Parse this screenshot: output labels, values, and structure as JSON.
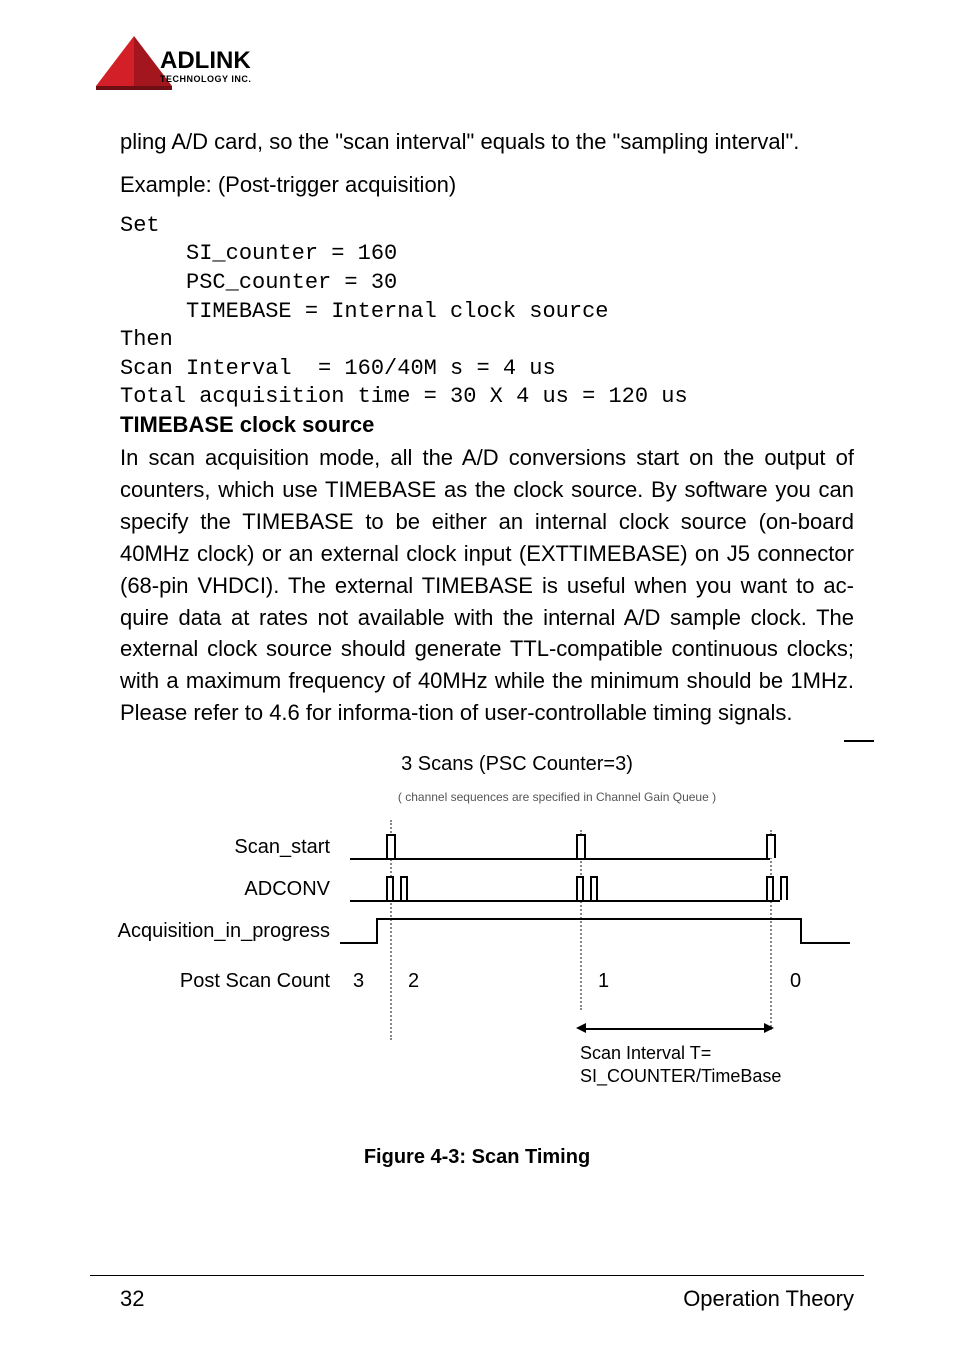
{
  "logo": {
    "brand_top": "ADLINK",
    "brand_bottom": "TECHNOLOGY INC."
  },
  "para1": "pling A/D card, so the \"scan interval\" equals to the \"sampling interval\".",
  "example_label": "Example: (Post-trigger acquisition)",
  "code_block": "Set\n     SI_counter = 160\n     PSC_counter = 30\n     TIMEBASE = Internal clock source\nThen\nScan Interval  = 160/40M s = 4 us\nTotal acquisition time = 30 X 4 us = 120 us",
  "heading_timebase": "TIMEBASE clock source",
  "para_timebase": "In scan acquisition mode, all the A/D conversions start on the output of counters, which use TIMEBASE as the clock source. By software you can specify the TIMEBASE to be either an internal clock source (on-board 40MHz clock) or an external clock input (EXTTIMEBASE) on J5 connector (68-pin VHDCI). The external TIMEBASE is useful when you want to ac-quire data at rates not available with the internal A/D sample clock. The external clock source should generate TTL-compatible continuous clocks; with a maximum frequency of 40MHz while the minimum should be 1MHz. Please refer to 4.6 for informa-tion of user-controllable timing signals.",
  "diagram": {
    "title": "3 Scans (PSC  Counter=3)",
    "subtitle": "( channel sequences are specified in Channel Gain Queue )",
    "signals": {
      "scan_start": "Scan_start",
      "adconv": "ADCONV",
      "acq_prog": "Acquisition_in_progress",
      "post_scan": "Post Scan Count"
    },
    "counts": [
      "3",
      "2",
      "1",
      "0"
    ],
    "scan_interval_label": "Scan Interval T=\nSI_COUNTER/TimeBase"
  },
  "figure_caption": "Figure 4-3: Scan Timing",
  "footer": {
    "page": "32",
    "section": "Operation Theory"
  }
}
